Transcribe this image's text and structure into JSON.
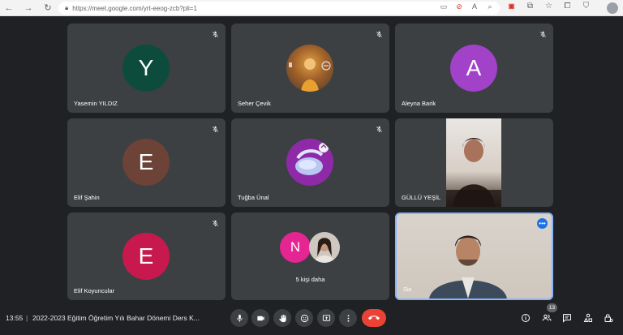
{
  "browser": {
    "url": "https://meet.google.com/yrt-eeog-zcb?pli=1"
  },
  "tiles": [
    {
      "name": "Yasemin YILDIZ",
      "initial": "Y",
      "color": "#0d4c3c"
    },
    {
      "name": "Seher Çevik"
    },
    {
      "name": "Aleyna Barik",
      "initial": "A",
      "color": "#a142c9"
    },
    {
      "name": "Elif Şahin",
      "initial": "E",
      "color": "#6d4237"
    },
    {
      "name": "Tuğba Ünal"
    },
    {
      "name": "GÜLLÜ YEŞİL"
    },
    {
      "name": "Elif Koyuncular",
      "initial": "E",
      "color": "#c8194f"
    },
    {
      "others_label": "5 kişi daha",
      "initial": "N",
      "color": "#e52592"
    },
    {
      "name": "Siz"
    }
  ],
  "bottom": {
    "time": "13:55",
    "separator": "|",
    "meeting_title": "2022-2023 Eğitim Öğretim Yılı Bahar Dönemi Ders K...",
    "participants_count": "13"
  },
  "colors": {
    "background": "#202124",
    "tile": "#3c4043",
    "end_call": "#ea4335",
    "accent": "#1a73e8"
  },
  "icons": [
    "back-icon",
    "forward-icon",
    "reload-icon",
    "lock-icon",
    "mic-off-icon",
    "mic-icon",
    "camera-icon",
    "raise-hand-icon",
    "emoji-icon",
    "present-icon",
    "more-options-icon",
    "end-call-icon",
    "info-icon",
    "people-icon",
    "chat-icon",
    "activities-icon",
    "host-controls-icon"
  ]
}
